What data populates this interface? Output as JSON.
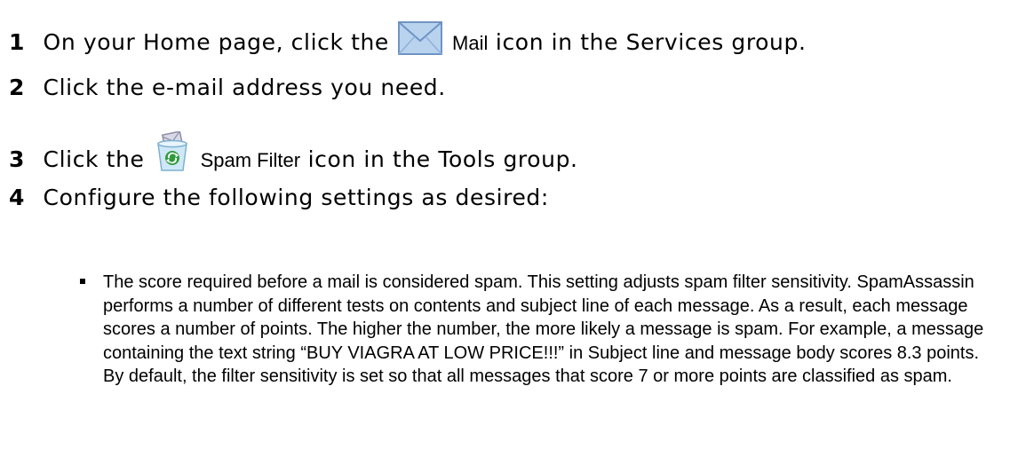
{
  "steps": [
    {
      "number": "1",
      "before": "On your Home page, click the",
      "ui_term": "Mail",
      "after": "icon in the Services group.",
      "icon": "mail-envelope-icon"
    },
    {
      "number": "2",
      "text": "Click the e-mail address you need."
    },
    {
      "number": "3",
      "before": "Click the",
      "ui_term": "Spam Filter",
      "after": "icon in the Tools group.",
      "icon": "spam-filter-icon"
    },
    {
      "number": "4",
      "text": "Configure the following settings as desired:"
    }
  ],
  "bullet": {
    "lead": "The score required before a mail is considered spam.",
    "text": "This setting adjusts spam filter sensitivity. SpamAssassin performs a number of different tests on contents and subject line of each message. As a result, each message scores a number of points. The higher the number, the more likely a message is spam. For example, a message containing the text string “BUY VIAGRA AT LOW PRICE!!!” in Subject line and message body scores 8.3 points. By default, the filter sensitivity is set so that all messages that score 7 or more points are classified as spam."
  },
  "colors": {
    "envelope_fill": "#b9d3ee",
    "envelope_stroke": "#6f94c4",
    "bin_fill": "#cfe8f7",
    "bin_accent": "#2f9a3c"
  }
}
